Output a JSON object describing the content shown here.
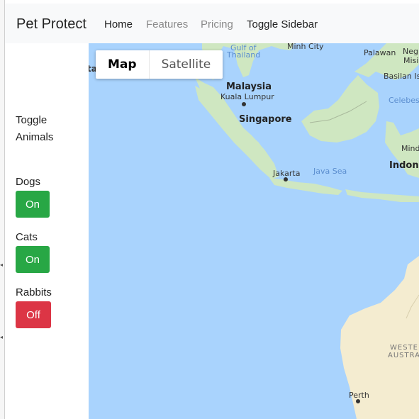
{
  "navbar": {
    "brand": "Pet Protect",
    "links": [
      {
        "label": "Home",
        "active": true
      },
      {
        "label": "Features",
        "active": false
      },
      {
        "label": "Pricing",
        "active": false
      },
      {
        "label": "Toggle Sidebar",
        "active": true
      }
    ]
  },
  "sidebar": {
    "title": "Toggle Animals",
    "animals": [
      {
        "name": "Dogs",
        "state": "On",
        "color": "#28a745"
      },
      {
        "name": "Cats",
        "state": "On",
        "color": "#28a745"
      },
      {
        "name": "Rabbits",
        "state": "Off",
        "color": "#dc3545"
      }
    ]
  },
  "map": {
    "type_control": {
      "map": "Map",
      "satellite": "Satellite"
    },
    "colors": {
      "water": "#a9d3fd",
      "land": "#cfe7c1",
      "desert": "#f4ecd0"
    },
    "labels": {
      "gulf": "Gulf of",
      "thailand": "Thailand",
      "minh": "Minh City",
      "palawan": "Palawan",
      "negros": "Negr",
      "basilan": "Basilan Isl",
      "malaysia": "Malaysia",
      "kuala": "Kuala Lumpur",
      "celebes": "Celebes",
      "singapore": "Singapore",
      "indone": "Indone",
      "jakarta": "Jakarta",
      "java": "Java Sea",
      "ta": "ta",
      "western1": "WESTER",
      "western2": "AUSTRA",
      "perth": "Perth",
      "mindi": "Mind",
      "misi": "Misi"
    }
  }
}
